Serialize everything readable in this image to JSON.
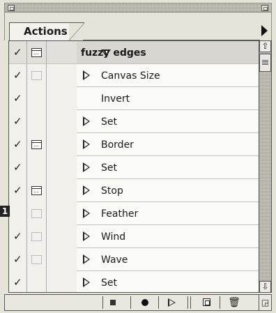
{
  "palette": {
    "tab_label": "Actions"
  },
  "action_set": {
    "name": "fuzzy edges",
    "expanded": true
  },
  "actions": [
    {
      "label": "Canvas Size",
      "checked": true,
      "dialog": "empty",
      "expandable": true
    },
    {
      "label": "Invert",
      "checked": true,
      "dialog": "none",
      "expandable": false
    },
    {
      "label": "Set",
      "checked": true,
      "dialog": "none",
      "expandable": true
    },
    {
      "label": "Border",
      "checked": true,
      "dialog": "on",
      "expandable": true
    },
    {
      "label": "Set",
      "checked": true,
      "dialog": "none",
      "expandable": true
    },
    {
      "label": "Stop",
      "checked": true,
      "dialog": "on",
      "expandable": true
    },
    {
      "label": "Feather",
      "checked": false,
      "dialog": "empty",
      "expandable": true
    },
    {
      "label": "Wind",
      "checked": true,
      "dialog": "empty",
      "expandable": true
    },
    {
      "label": "Wave",
      "checked": true,
      "dialog": "empty",
      "expandable": true
    },
    {
      "label": "Set",
      "checked": true,
      "dialog": "none",
      "expandable": true
    }
  ],
  "icons": {
    "check": "✓",
    "trash": "🗑",
    "scroll_up": "⇧",
    "scroll_down": "⇩"
  },
  "callout": {
    "number": "1"
  }
}
